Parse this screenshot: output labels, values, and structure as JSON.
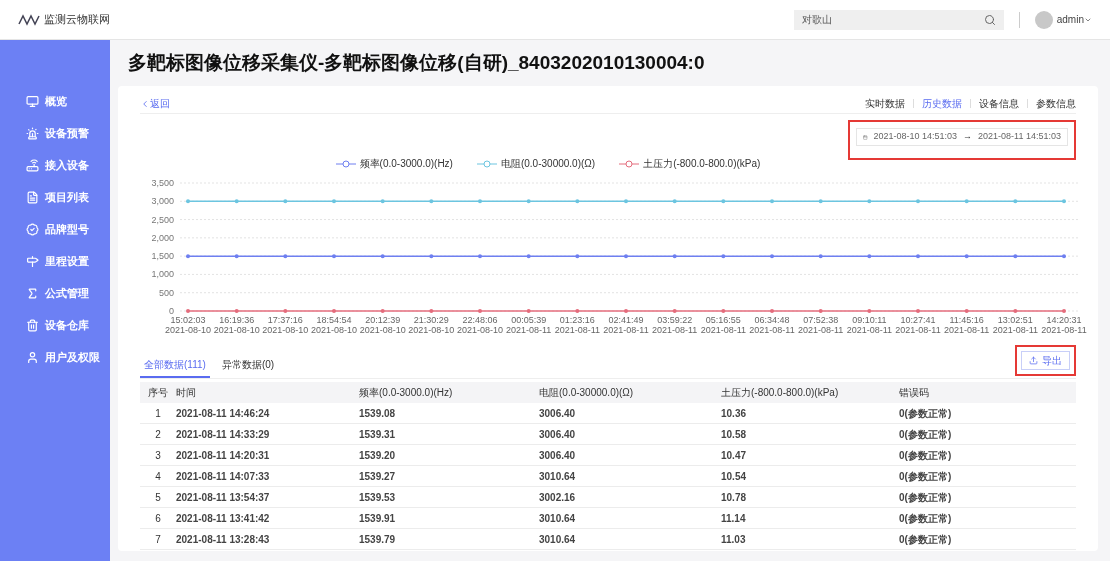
{
  "app": {
    "name": "监测云物联网"
  },
  "header": {
    "search": {
      "value": "对歌山"
    },
    "user": "admin"
  },
  "sidebar": {
    "items": [
      {
        "label": "概览"
      },
      {
        "label": "设备预警"
      },
      {
        "label": "接入设备"
      },
      {
        "label": "项目列表"
      },
      {
        "label": "品牌型号"
      },
      {
        "label": "里程设置"
      },
      {
        "label": "公式管理"
      },
      {
        "label": "设备仓库"
      },
      {
        "label": "用户及权限"
      }
    ]
  },
  "page": {
    "title": "多靶标图像位移采集仪-多靶标图像位移(自研)_8403202010130004:0",
    "back": "返回"
  },
  "view_tabs": [
    {
      "label": "实时数据",
      "selected": false
    },
    {
      "label": "历史数据",
      "selected": true
    },
    {
      "label": "设备信息",
      "selected": false
    },
    {
      "label": "参数信息",
      "selected": false
    }
  ],
  "date_range": {
    "start": "2021-08-10 14:51:03",
    "separator": "→",
    "end": "2021-08-11 14:51:03",
    "highlighted": true
  },
  "chart_data": {
    "type": "line",
    "categories": [
      "15:02:03 2021-08-10",
      "16:19:36 2021-08-10",
      "17:37:16 2021-08-10",
      "18:54:54 2021-08-10",
      "20:12:39 2021-08-10",
      "21:30:29 2021-08-10",
      "22:48:06 2021-08-10",
      "00:05:39 2021-08-11",
      "01:23:16 2021-08-11",
      "02:41:49 2021-08-11",
      "03:59:22 2021-08-11",
      "05:16:55 2021-08-11",
      "06:34:48 2021-08-11",
      "07:52:38 2021-08-11",
      "09:10:11 2021-08-11",
      "10:27:41 2021-08-11",
      "11:45:16 2021-08-11",
      "13:02:51 2021-08-11",
      "14:20:31 2021-08-11"
    ],
    "ylim": [
      0,
      3500
    ],
    "grid": true,
    "legend": true,
    "yticks": [
      {
        "value": 0,
        "label": "0"
      },
      {
        "value": 500,
        "label": "500"
      },
      {
        "value": 1000,
        "label": "1,000"
      },
      {
        "value": 1500,
        "label": "1,500"
      },
      {
        "value": 2000,
        "label": "2,000"
      },
      {
        "value": 2500,
        "label": "2,500"
      },
      {
        "value": 3000,
        "label": "3,000"
      },
      {
        "value": 3500,
        "label": "3,500"
      }
    ],
    "series": [
      {
        "name": "频率(0.0-3000.0)(Hz)",
        "color": "#6e7ff0",
        "values": [
          1500,
          1500,
          1500,
          1500,
          1500,
          1500,
          1500,
          1500,
          1500,
          1500,
          1500,
          1500,
          1500,
          1500,
          1500,
          1500,
          1500,
          1500,
          1500
        ]
      },
      {
        "name": "电阻(0.0-30000.0)(Ω)",
        "color": "#6cc5e0",
        "values": [
          3000,
          3000,
          3000,
          3000,
          3000,
          3000,
          3000,
          3000,
          3000,
          3000,
          3000,
          3000,
          3000,
          3000,
          3000,
          3000,
          3000,
          3000,
          3000
        ]
      },
      {
        "name": "土压力(-800.0-800.0)(kPa)",
        "color": "#e46c7c",
        "values": [
          0,
          0,
          0,
          0,
          0,
          0,
          0,
          0,
          0,
          0,
          0,
          0,
          0,
          0,
          0,
          0,
          0,
          0,
          0
        ]
      }
    ]
  },
  "data_tabs": [
    {
      "label": "全部数据(111)",
      "selected": true
    },
    {
      "label": "异常数据(0)",
      "selected": false
    }
  ],
  "export_button": {
    "label": "导出",
    "highlighted": true
  },
  "table": {
    "columns": [
      "序号",
      "时间",
      "频率(0.0-3000.0)(Hz)",
      "电阻(0.0-30000.0)(Ω)",
      "土压力(-800.0-800.0)(kPa)",
      "错误码"
    ],
    "rows": [
      [
        "1",
        "2021-08-11 14:46:24",
        "1539.08",
        "3006.40",
        "10.36",
        "0(参数正常)"
      ],
      [
        "2",
        "2021-08-11 14:33:29",
        "1539.31",
        "3006.40",
        "10.58",
        "0(参数正常)"
      ],
      [
        "3",
        "2021-08-11 14:20:31",
        "1539.20",
        "3006.40",
        "10.47",
        "0(参数正常)"
      ],
      [
        "4",
        "2021-08-11 14:07:33",
        "1539.27",
        "3010.64",
        "10.54",
        "0(参数正常)"
      ],
      [
        "5",
        "2021-08-11 13:54:37",
        "1539.53",
        "3002.16",
        "10.78",
        "0(参数正常)"
      ],
      [
        "6",
        "2021-08-11 13:41:42",
        "1539.91",
        "3010.64",
        "11.14",
        "0(参数正常)"
      ],
      [
        "7",
        "2021-08-11 13:28:43",
        "1539.79",
        "3010.64",
        "11.03",
        "0(参数正常)"
      ]
    ]
  }
}
